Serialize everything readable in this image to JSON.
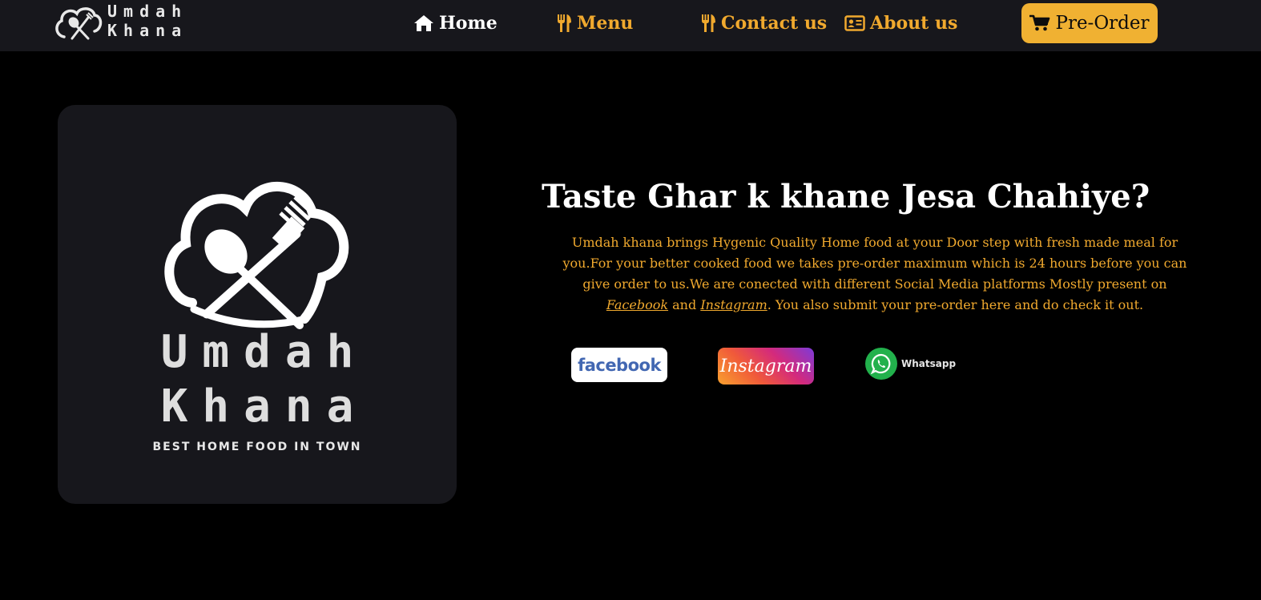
{
  "navbar": {
    "brand": {
      "line1": "Umdah",
      "line2": "Khana"
    },
    "links": [
      {
        "label": "Home",
        "icon": "home-icon"
      },
      {
        "label": "Menu",
        "icon": "utensils-icon"
      },
      {
        "label": "Contact us",
        "icon": "utensils-icon"
      },
      {
        "label": "About us",
        "icon": "id-card-icon"
      }
    ],
    "preorder": {
      "label": "Pre-Order",
      "icon": "cart-icon"
    }
  },
  "logo_card": {
    "line1": "Umdah",
    "line2": "Khana",
    "tagline": "BEST HOME FOOD IN TOWN"
  },
  "hero": {
    "title": "Taste Ghar k khane Jesa Chahiye?",
    "text_part1": "Umdah khana brings Hygenic Quality Home food at your Door step with fresh made meal for you.For your better cooked food we takes pre-order maximum which is 24 hours before you can give order to us.We are conected with different Social Media platforms Mostly present on",
    "facebook_link": "Facebook",
    "and_word": "and",
    "instagram_link": "Instagram",
    "text_part2": ". You also submit your pre-order here and do check it out."
  },
  "social": {
    "facebook": "facebook",
    "instagram": "Instagram",
    "whatsapp": "Whatsapp"
  },
  "colors": {
    "accent": "#f0a92e",
    "button": "#f0b132",
    "navbar_bg": "#17171c",
    "page_bg": "#000000"
  }
}
